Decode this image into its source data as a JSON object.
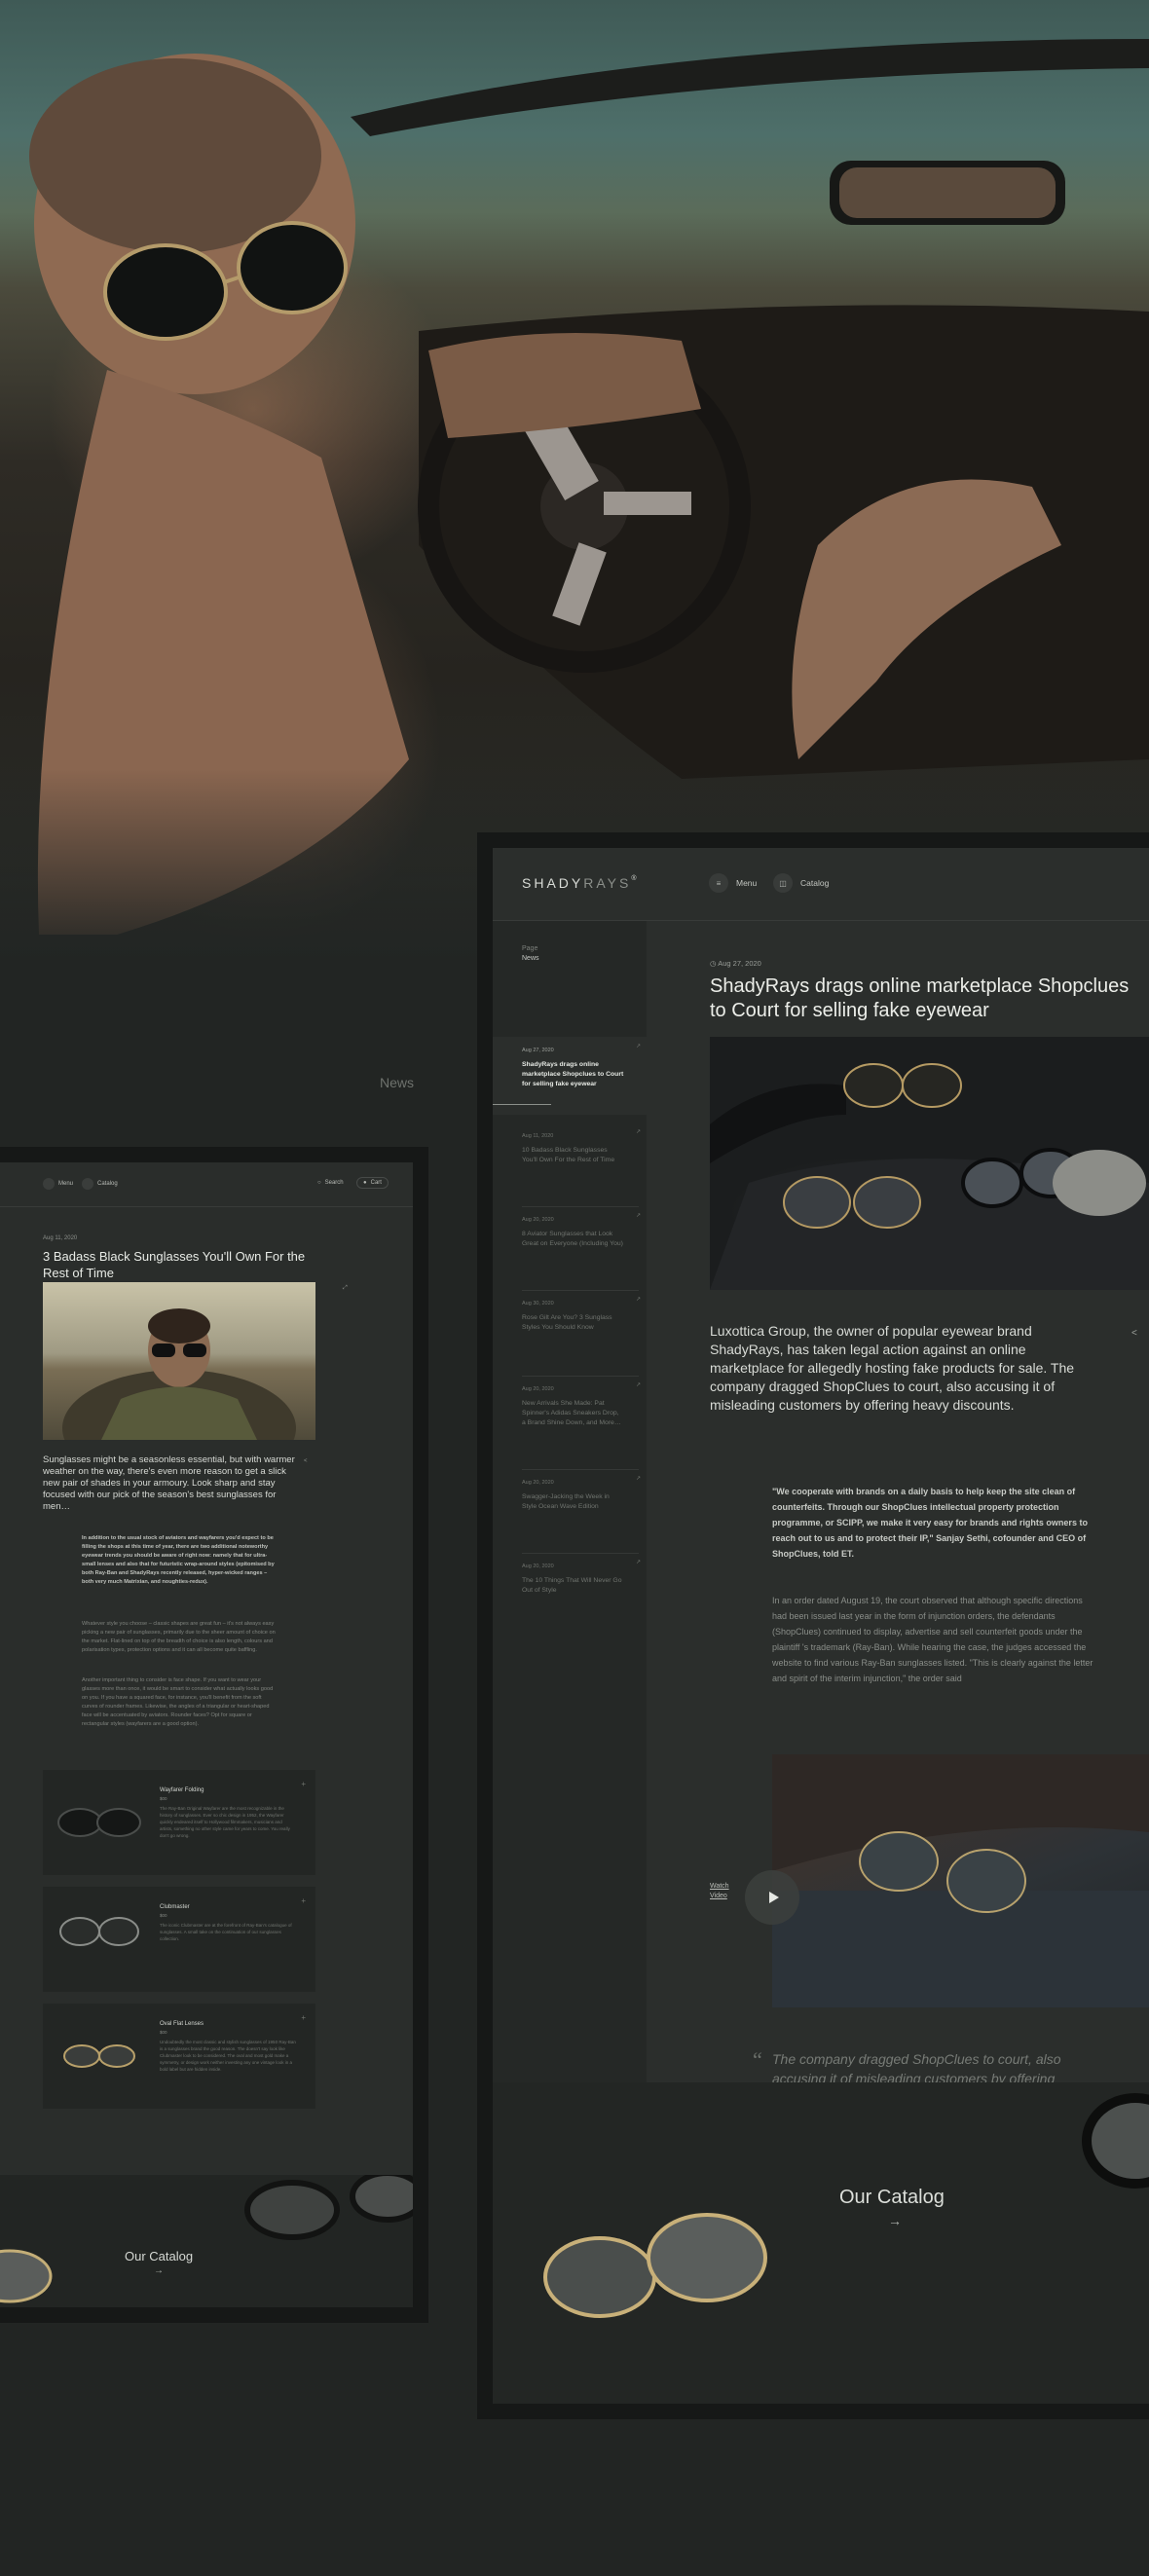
{
  "news_label": "News",
  "left_mock": {
    "nav": {
      "menu": "Menu",
      "catalog": "Catalog",
      "search": "Search",
      "cart": "Cart"
    },
    "date": "Aug 11, 2020",
    "title": "3 Badass Black Sunglasses You'll Own For the Rest of Time",
    "lead": "Sunglasses might be a seasonless essential, but with warmer weather on the way, there's even more reason to get a slick new pair of shades in your armoury. Look sharp and stay focused with our pick of the season's best sunglasses for men…",
    "quote": "In addition to the usual stock of aviators and wayfarers you'd expect to be filling the shops at this time of year, there are two additional noteworthy eyewear trends you should be aware of right now: namely that for ultra-small lenses and also that for futuristic wrap-around styles (epitomised by both Ray-Ban and ShadyRays recently released, hyper-wicked ranges – both very much Matrixian, and noughties-redux).",
    "paragraphs": [
      "Whatever style you choose – classic shapes are great fun – it's not always easy picking a new pair of sunglasses, primarily due to the sheer amount of choice on the market. Flat-lined on top of the breadth of choice is also length, colours and polarisation types, protection options and it can all become quite baffling.",
      "Another important thing to consider is face shape. If you want to wear your glasses more than once, it would be smart to consider what actually looks good on you. If you have a squared face, for instance, you'll benefit from the soft curves of rounder frames. Likewise, the angles of a triangular or heart-shaped face will be accentuated by aviators. Rounder faces? Opt for square or rectangular styles (wayfarers are a good option)."
    ],
    "products": [
      {
        "name": "Wayfarer Folding",
        "sub": "$00",
        "desc": "The Ray-Ban Original Wayfarer are the most recognizable in the history of sunglasses. Ever so chic design in 1952, the Wayfarer quickly endeared itself to Hollywood filmmakers, musicians and artists, something no other style came for years to come. You really don't go wrong."
      },
      {
        "name": "Clubmaster",
        "sub": "$00",
        "desc": "The iconic Clubmaster are at the forefront of Ray-Ban's catalogue of sunglasses. A small take on the continuation of our sunglasses collection."
      },
      {
        "name": "Oval Flat Lenses",
        "sub": "$00",
        "desc": "Undoubtedly the most classic and stylish sunglasses of 1950 Ray-Ban is a sunglasses brand the good reason. The doesn't say look like Clubmaster look to be considered. The oval and most gold make a symmetry, or design work neither investing any one vintage look in a bold label but are hidden inside."
      }
    ],
    "catalog": {
      "title": "Our Catalog",
      "arrow": "→"
    }
  },
  "right_mock": {
    "logo_bold": "SHADY",
    "logo_light": "RAYS",
    "logo_mark": "®",
    "nav": {
      "menu": "Menu",
      "catalog": "Catalog",
      "menu_icon": "≡",
      "catalog_icon": "◫"
    },
    "page_label": "Page",
    "page_value": "News",
    "sidebar": [
      {
        "date": "Aug 27, 2020",
        "title": "ShadyRays drags online marketplace Shopclues to Court for selling fake eyewear",
        "active": true
      },
      {
        "date": "Aug 11, 2020",
        "title": "10 Badass Black Sunglasses You'll Own For the Rest of Time",
        "active": false
      },
      {
        "date": "Aug 20, 2020",
        "title": "8 Aviator Sunglasses that Look Great on Everyone (Including You)",
        "active": false
      },
      {
        "date": "Aug 30, 2020",
        "title": "Rose Gilt Are You? 3 Sunglass Styles You Should Know",
        "active": false
      },
      {
        "date": "Aug 20, 2020",
        "title": "New Arrivals She Made: Pat Spinner's Adidas Sneakers Drop, a Brand Shine Down, and More…",
        "active": false
      },
      {
        "date": "Aug 20, 2020",
        "title": "Swagger-Jacking the Week in Style Ocean Wave Edition",
        "active": false
      },
      {
        "date": "Aug 20, 2020",
        "title": "The 10 Things That Will Never Go Out of Style",
        "active": false
      }
    ],
    "date": "Aug 27, 2020",
    "title": "ShadyRays drags online marketplace Shopclues to Court for selling fake eyewear",
    "lead": "Luxottica Group, the owner of popular eyewear brand ShadyRays, has taken legal action against an online marketplace for allegedly hosting fake products for sale. The company dragged ShopClues to court, also accusing it of misleading customers by offering heavy discounts.",
    "quote": "\"We cooperate with brands on a daily basis to help keep the site clean of counterfeits. Through our ShopClues intellectual property protection programme, or SCIPP, we make it very easy for brands and rights owners to reach out to us and to protect their IP,\" Sanjay Sethi, cofounder and CEO of ShopClues, told ET.",
    "paragraph": "In an order dated August 19, the court observed that although specific directions had been issued last year in the form of injunction orders, the defendants (ShopClues) continued to display, advertise and sell counterfeit goods under the plaintiff 's trademark (Ray-Ban). While hearing the case, the judges accessed the website to find various Ray-Ban sunglasses listed. \"This is clearly against the letter and spirit of the interim injunction,\" the order said",
    "watch_video": "Watch Video",
    "pull_quote": "The company dragged ShopClues to court, also accusing it of misleading customers by offering heavy discounts.",
    "pull_mark": "“",
    "share_icon": "<",
    "catalog": {
      "title": "Our Catalog",
      "arrow": "→"
    }
  }
}
